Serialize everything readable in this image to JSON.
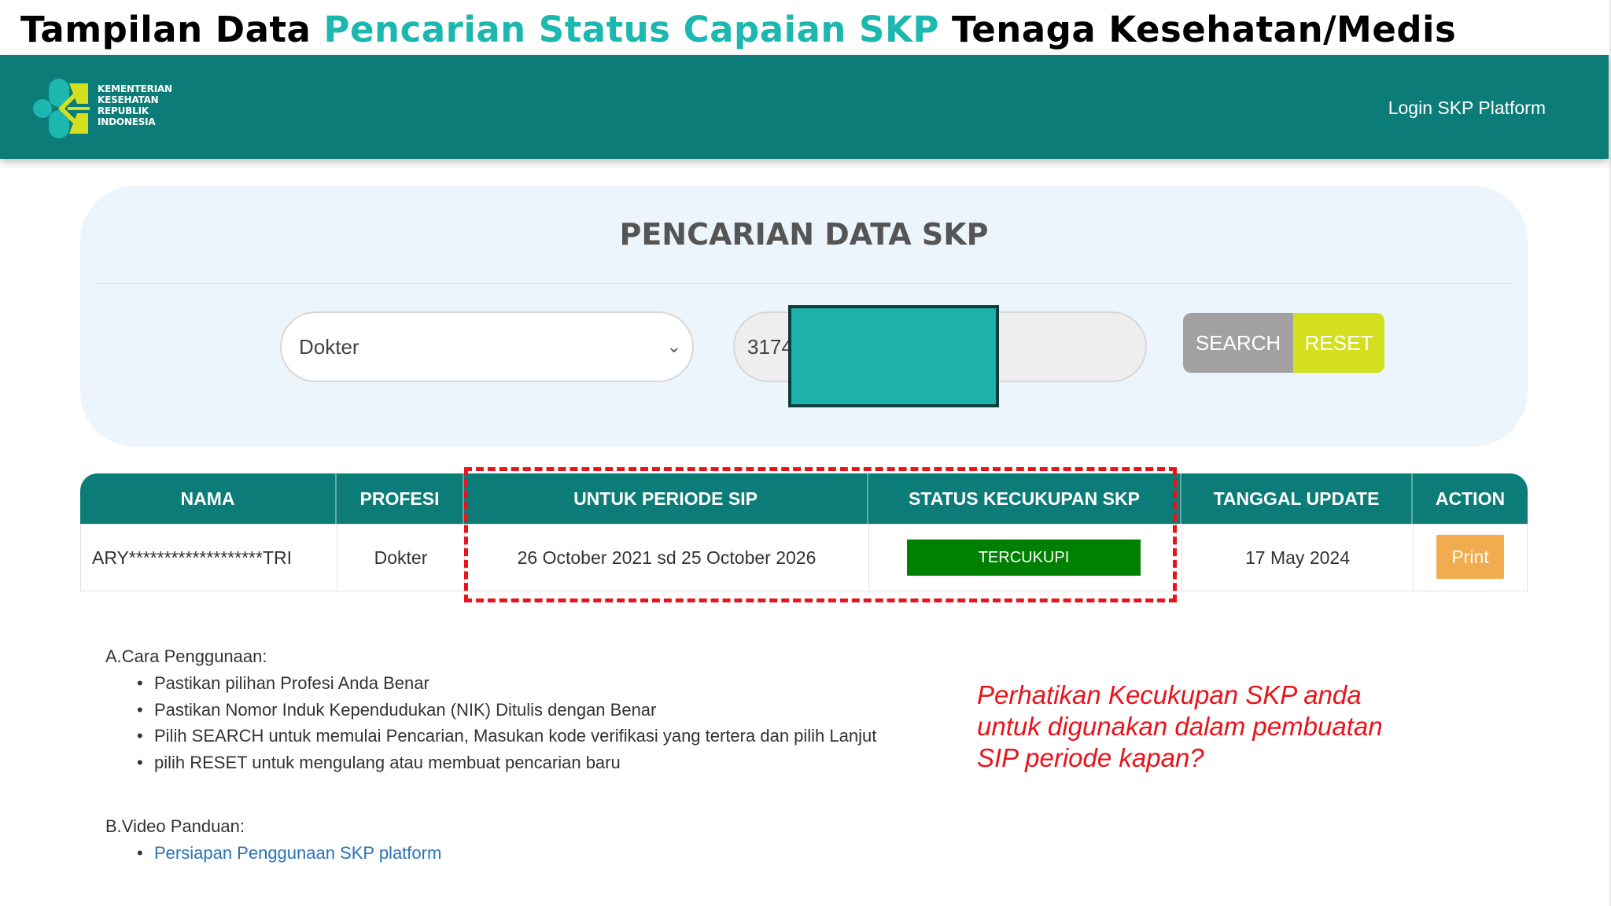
{
  "slide_title": {
    "prefix": "Tampilan Data ",
    "highlight": "Pencarian Status Capaian SKP",
    "suffix": " Tenaga Kesehatan/Medis"
  },
  "colors": {
    "brand_teal": "#0c7c78",
    "highlight_teal": "#1cb7ae",
    "status_green": "#008000",
    "print_orange": "#f0ac4e",
    "reset_lime": "#d4e01e",
    "search_grey": "#a1a1a1",
    "annotation_red": "#e8141b"
  },
  "navbar": {
    "logo_lines": [
      "KEMENTERIAN",
      "KESEHATAN",
      "REPUBLIK",
      "INDONESIA"
    ],
    "login_label": "Login SKP Platform"
  },
  "search": {
    "title": "PENCARIAN DATA SKP",
    "profesi_selected": "Dokter",
    "nik_value": "3174",
    "search_label": "SEARCH",
    "reset_label": "RESET"
  },
  "table": {
    "headers": [
      "NAMA",
      "PROFESI",
      "UNTUK PERIODE SIP",
      "STATUS KECUKUPAN SKP",
      "TANGGAL UPDATE",
      "ACTION"
    ],
    "rows": [
      {
        "nama": "ARY*******************TRI",
        "profesi": "Dokter",
        "periode": "26 October 2021 sd 25 October 2026",
        "status": "TERCUKUPI",
        "tanggal": "17 May 2024",
        "action": "Print"
      }
    ]
  },
  "guide": {
    "a_heading": "A.Cara Penggunaan:",
    "a_items": [
      "Pastikan pilihan Profesi Anda Benar",
      "Pastikan Nomor Induk Kependudukan (NIK) Ditulis dengan Benar",
      "Pilih SEARCH untuk memulai Pencarian, Masukan kode verifikasi yang tertera dan pilih Lanjut",
      "pilih RESET untuk mengulang atau membuat pencarian baru"
    ],
    "b_heading": "B.Video Panduan:",
    "b_link": "Persiapan Penggunaan SKP platform"
  },
  "annotation": {
    "lines": [
      "Perhatikan Kecukupan SKP anda",
      "untuk digunakan dalam pembuatan",
      "SIP periode kapan?"
    ]
  }
}
